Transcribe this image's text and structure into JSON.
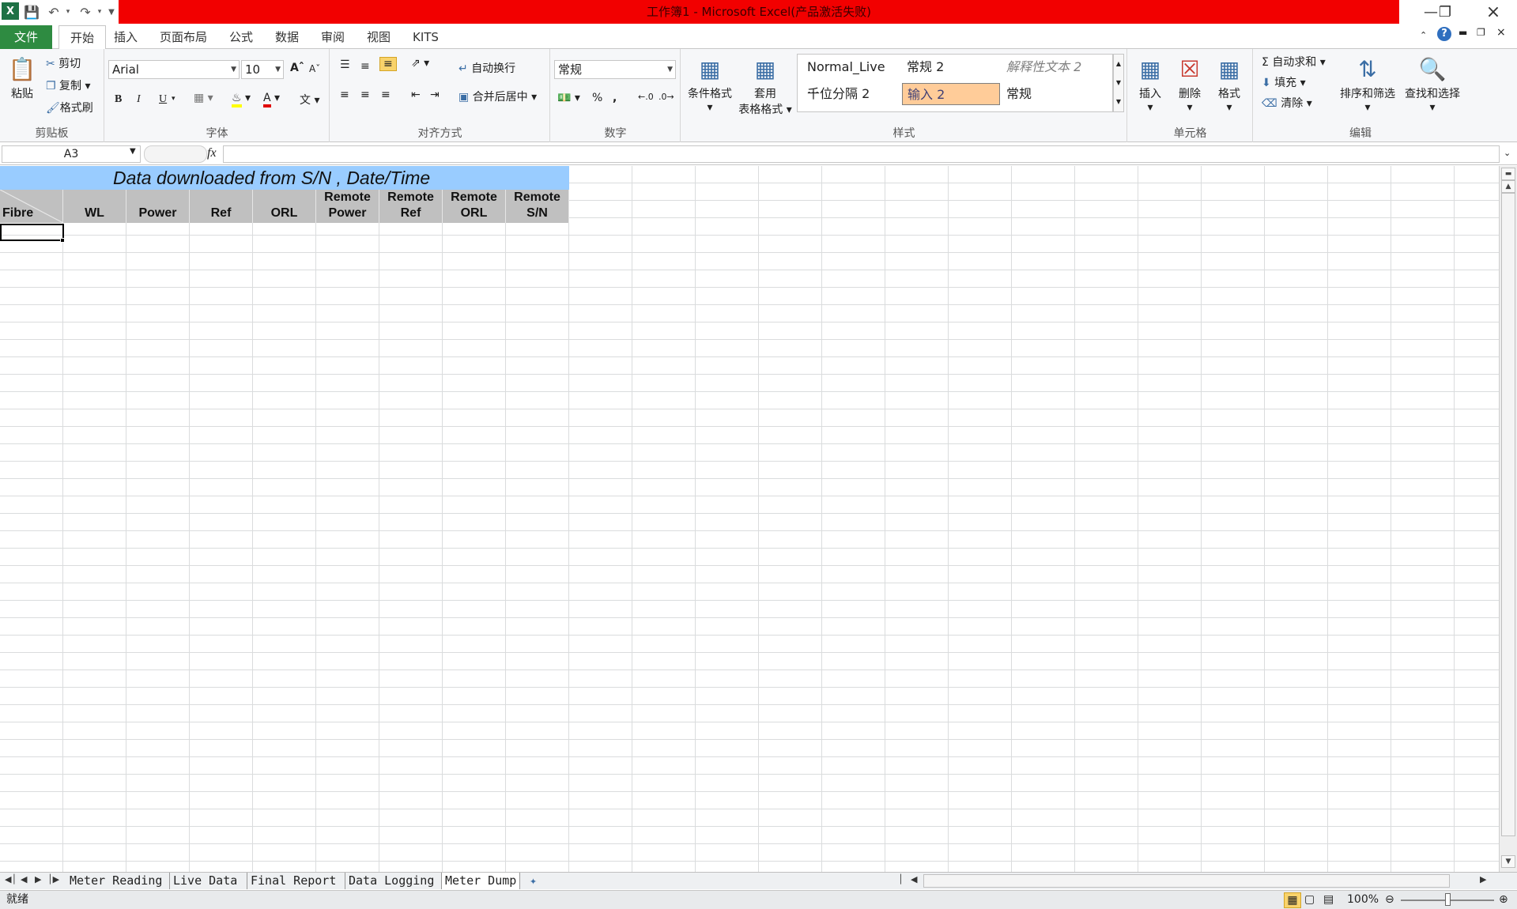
{
  "window": {
    "title": "工作簿1 - Microsoft Excel(产品激活失败)"
  },
  "menu": {
    "tabs": [
      "文件",
      "开始",
      "插入",
      "页面布局",
      "公式",
      "数据",
      "审阅",
      "视图",
      "KITS"
    ]
  },
  "ribbon": {
    "clipboard": {
      "paste": "粘贴",
      "cut": "剪切",
      "copy": "复制",
      "format_painter": "格式刷",
      "label": "剪贴板"
    },
    "font": {
      "name": "Arial",
      "size": "10",
      "bold": "B",
      "italic": "I",
      "underline": "U",
      "label": "字体"
    },
    "alignment": {
      "wrap": "自动换行",
      "merge": "合并后居中",
      "label": "对齐方式"
    },
    "number": {
      "format": "常规",
      "percent": "%",
      "comma": ",",
      "label": "数字"
    },
    "styles": {
      "conditional": "条件格式",
      "table_line1": "套用",
      "table_line2": "表格格式",
      "cells": [
        "Normal_Live ...",
        "常规 2",
        "解释性文本 2",
        "千位分隔 2",
        "输入 2",
        "常规"
      ],
      "label": "样式"
    },
    "cells": {
      "insert": "插入",
      "delete": "删除",
      "format": "格式",
      "label": "单元格"
    },
    "editing": {
      "autosum": "自动求和",
      "fill": "填充",
      "clear": "清除",
      "sort": "排序和筛选",
      "find": "查找和选择",
      "label": "编辑"
    }
  },
  "formula_bar": {
    "name_box": "A3",
    "fx": "fx",
    "content": ""
  },
  "sheet": {
    "banner": "Data downloaded from S/N     , Date/Time",
    "headers": [
      [
        "Fibre"
      ],
      [
        "WL"
      ],
      [
        "Power"
      ],
      [
        "Ref"
      ],
      [
        "ORL"
      ],
      [
        "Remote",
        "Power"
      ],
      [
        "Remote",
        "Ref"
      ],
      [
        "Remote",
        "ORL"
      ],
      [
        "Remote",
        "S/N"
      ]
    ],
    "header_bg": "#c0c0c0",
    "banner_bg": "#99ccff"
  },
  "sheet_tabs": [
    "Meter Reading",
    "Live Data",
    "Final Report",
    "Data Logging",
    "Meter Dump"
  ],
  "active_sheet": "Meter Dump",
  "status": {
    "ready": "就绪",
    "zoom": "100%"
  }
}
